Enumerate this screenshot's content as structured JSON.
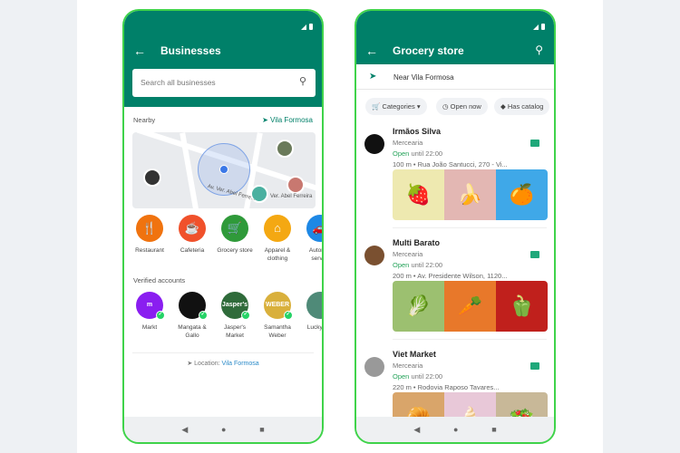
{
  "left_screen": {
    "title": "Businesses",
    "search_placeholder": "Search all businesses",
    "nearby_label": "Nearby",
    "nearby_location": "Vila Formosa",
    "map_street_labels": [
      "Av. Ver. Abel Ferre...",
      "Ver. Abel Ferreira"
    ],
    "categories": [
      {
        "label": "Restaurant",
        "icon": "fork-knife-icon",
        "color": "#f0730f"
      },
      {
        "label": "Cafeteria",
        "icon": "cafe-icon",
        "color": "#f0512b"
      },
      {
        "label": "Grocery store",
        "icon": "cart-icon",
        "color": "#2f9a3a"
      },
      {
        "label": "Apparel & clothing",
        "icon": "hanger-icon",
        "color": "#f4a812"
      },
      {
        "label": "Autom... servi...",
        "icon": "car-icon",
        "color": "#1e88e5"
      }
    ],
    "verified_label": "Verified accounts",
    "verified": [
      {
        "label": "Markt",
        "logo": "m",
        "color": "#8a1ef0"
      },
      {
        "label": "Mangata & Gallo",
        "logo": "",
        "color": "#111111"
      },
      {
        "label": "Jasper's Market",
        "logo": "Jasper's",
        "color": "#2f6b3a"
      },
      {
        "label": "Samantha Weber",
        "logo": "WEBER",
        "color": "#d9b03c"
      },
      {
        "label": "Lucky S...",
        "logo": "",
        "color": "#4f8a78"
      }
    ],
    "location_prefix": "Location:",
    "location_value": "Vila Formosa"
  },
  "right_screen": {
    "title": "Grocery store",
    "near_label": "Near Vila Formosa",
    "chips": [
      "Categories",
      "Open now",
      "Has catalog"
    ],
    "businesses": [
      {
        "name": "Irmãos Silva",
        "type": "Mercearia",
        "open": "Open",
        "hours": "until 22:00",
        "address": "100 m • Rua João Santucci, 270 - Vi...",
        "avatar_color": "#111111",
        "images": [
          {
            "icon": "🍓",
            "bg": "#eee9b0"
          },
          {
            "icon": "🍌",
            "bg": "#e3b7b3"
          },
          {
            "icon": "🍊",
            "bg": "#3fa8e8"
          }
        ]
      },
      {
        "name": "Multi Barato",
        "type": "Mercearia",
        "open": "Open",
        "hours": "until 22:00",
        "address": "200 m • Av. Presidente Wilson, 1120...",
        "avatar_color": "#7a5030",
        "images": [
          {
            "icon": "🥬",
            "bg": "#9cc070"
          },
          {
            "icon": "🥕",
            "bg": "#e8782a"
          },
          {
            "icon": "🫑",
            "bg": "#c0201c"
          }
        ]
      },
      {
        "name": "Viet Market",
        "type": "Mercearia",
        "open": "Open",
        "hours": "until 22:00",
        "address": "220 m • Rodovia Raposo Tavares...",
        "avatar_color": "#999999",
        "images": [
          {
            "icon": "🥐",
            "bg": "#d9a56a"
          },
          {
            "icon": "🍦",
            "bg": "#e8c8d8"
          },
          {
            "icon": "🥗",
            "bg": "#c8b898"
          }
        ]
      }
    ]
  },
  "colors": {
    "header": "#008069",
    "accent": "#25d366",
    "frame": "#3fd34a"
  }
}
